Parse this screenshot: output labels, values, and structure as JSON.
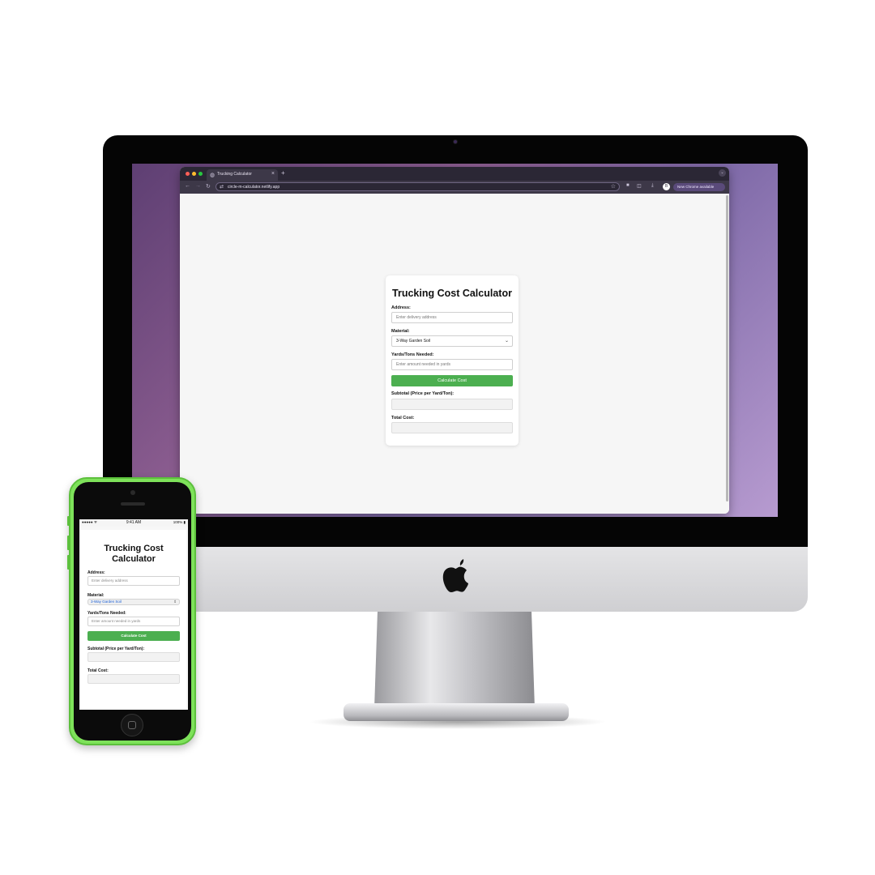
{
  "browser": {
    "tab_title": "Trucking Calculator",
    "tab_close": "×",
    "new_tab": "+",
    "url": "circle-m-calculator.netlify.app",
    "update_label": "New Chrome available",
    "profile_initial": "B"
  },
  "calculator": {
    "title": "Trucking Cost Calculator",
    "address_label": "Address:",
    "address_placeholder": "Enter delivery address",
    "material_label": "Material:",
    "material_value": "3-Way Garden Soil",
    "amount_label": "Yards/Tons Needed:",
    "amount_placeholder": "Enter amount needed in yards",
    "button_label": "Calculate Cost",
    "subtotal_label": "Subtotal (Price per Yard/Ton):",
    "total_label": "Total Cost:"
  },
  "mobile": {
    "signal": "●●●●● ᯤ",
    "time": "9:41 AM",
    "battery": "100% ▮",
    "title_line1": "Trucking Cost",
    "title_line2": "Calculator"
  },
  "colors": {
    "accent_green": "#4caf50",
    "phone_body": "#7ee25a",
    "browser_chrome": "#3d3848"
  }
}
